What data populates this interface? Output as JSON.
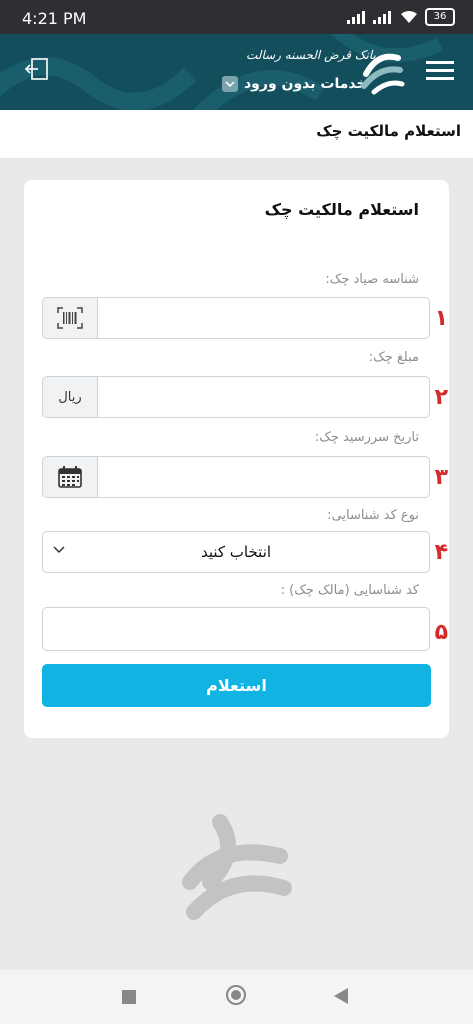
{
  "status_bar": {
    "time": "4:21 PM",
    "battery": "36"
  },
  "header": {
    "bank_name": "بانک قرض الحسنه رسالت",
    "services_label": "خدمات بدون ورود"
  },
  "page": {
    "title": "استعلام مالکیت چک"
  },
  "form": {
    "title": "استعلام مالکیت چک",
    "fields": [
      {
        "label": "شناسه صیاد چک:",
        "number": "۱",
        "value": "",
        "addon_icon": "barcode-icon"
      },
      {
        "label": "مبلغ چک:",
        "number": "۲",
        "value": "",
        "addon_text": "ریال"
      },
      {
        "label": "تاریخ سررسید چک:",
        "number": "۳",
        "value": "",
        "addon_icon": "calendar-icon"
      },
      {
        "label": "نوع کد شناسایی:",
        "number": "۴",
        "selected": "انتخاب کنید"
      },
      {
        "label": "کد شناسایی (مالک چک) :",
        "number": "۵",
        "value": ""
      }
    ],
    "submit_label": "استعلام"
  },
  "colors": {
    "header_bg": "#124e5c",
    "accent": "#11b3e3",
    "number_red": "#d42a2a"
  }
}
